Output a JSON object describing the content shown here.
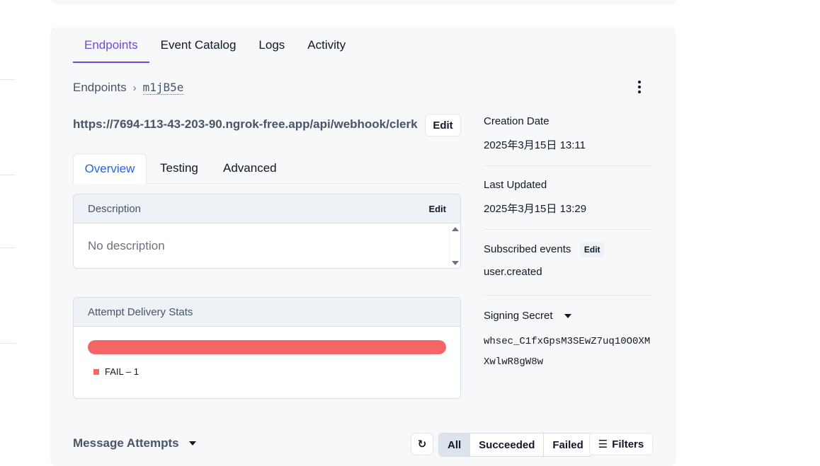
{
  "main_tabs": [
    "Endpoints",
    "Event Catalog",
    "Logs",
    "Activity"
  ],
  "breadcrumb": {
    "root": "Endpoints",
    "id": "m1jB5e"
  },
  "endpoint": {
    "url": "https://7694-113-43-203-90.ngrok-free.app/api/webhook/clerk",
    "edit_label": "Edit"
  },
  "sub_tabs": [
    "Overview",
    "Testing",
    "Advanced"
  ],
  "description": {
    "header": "Description",
    "edit_label": "Edit",
    "placeholder": "No description"
  },
  "delivery_stats": {
    "header": "Attempt Delivery Stats",
    "legend": "FAIL – 1",
    "fail_fraction": 1.0,
    "fail_color": "#f56565"
  },
  "meta": {
    "creation_label": "Creation Date",
    "creation_value": "2025年3月15日 13:11",
    "updated_label": "Last Updated",
    "updated_value": "2025年3月15日 13:29",
    "events_label": "Subscribed events",
    "events_edit": "Edit",
    "events_value": "user.created",
    "secret_label": "Signing Secret",
    "secret_value": "whsec_C1fxGpsM3SEwZ7uq10O0XMXwlwR8gW8w"
  },
  "message_attempts": {
    "title": "Message Attempts",
    "refresh_icon": "refresh-icon",
    "filter_options": [
      "All",
      "Succeeded",
      "Failed"
    ],
    "selected_filter": "All",
    "filters_label": "Filters"
  },
  "colors": {
    "accent": "#6d4ad8",
    "link": "#2563eb"
  }
}
